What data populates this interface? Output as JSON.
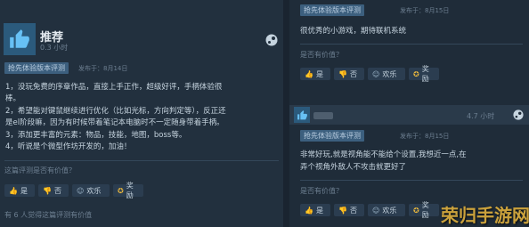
{
  "left_review": {
    "recommend_label": "推荐",
    "hours": "0.3 小时",
    "badge": "抢先体验版本评测",
    "posted": "发布于：8月14日",
    "lines": [
      "1，没玩免费的序章作品，直接上手正作，超级好评，手柄体验很",
      "棒。",
      "2，希望能对键鼠继续进行优化（比如光标，方向判定等），反正还",
      "是el阶段嘛，因为有时候带着笔记本电脑时不一定随身带着手柄。",
      "3，添加更丰富的元素：物品，技能，地图，boss等。",
      "4，听说是个微型作坊开发的，加油！"
    ],
    "helpful_q": "这篇评测是否有价值？",
    "yes": "是",
    "no": "否",
    "funny": "欢乐",
    "award": "奖励",
    "footer": "有 6 人觉得这篇评测有价值"
  },
  "right_top": {
    "badge": "抢先体验版本评测",
    "posted": "发布于：8月15日",
    "text": "很优秀的小游戏，期待联机系统",
    "helpful_q": "是否有价值？",
    "yes": "是",
    "no": "否",
    "funny": "欢乐",
    "award": "奖励"
  },
  "right_bottom": {
    "hours": "4.7 小时",
    "badge": "抢先体验版本评测",
    "posted": "发布于：8月15日",
    "lines": [
      "非常好玩,就是视角能不能给个设置,我想近一点,在",
      "弄个视角外敌人不攻击就更好了"
    ],
    "helpful_q": "是否有价值？",
    "yes": "是",
    "no": "否",
    "funny": "欢乐",
    "award": "奖励"
  },
  "watermark": "荣归手游网",
  "colors": {
    "accent": "#67c1f5",
    "gold": "#e9b73d"
  }
}
